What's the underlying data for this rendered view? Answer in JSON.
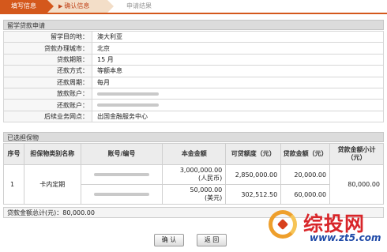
{
  "steps": {
    "step1": "填写信息",
    "step2": "确认信息",
    "step3": "申请结果"
  },
  "loan_section": {
    "title": "留学贷款申请",
    "rows": [
      {
        "label": "留学目的地：",
        "value": "澳大利亚"
      },
      {
        "label": "贷款办理城市：",
        "value": "北京"
      },
      {
        "label": "贷款期限：",
        "value": "15 月"
      },
      {
        "label": "还款方式：",
        "value": "等额本息"
      },
      {
        "label": "还款周期：",
        "value": "每月"
      },
      {
        "label": "放款账户：",
        "value": ""
      },
      {
        "label": "还款账户：",
        "value": ""
      },
      {
        "label": "后续业务网点：",
        "value": "出国金融服务中心"
      }
    ]
  },
  "collateral_section": {
    "title": "已选担保物",
    "headers": {
      "seq": "序号",
      "type": "担保物类别名称",
      "account": "账号/编号",
      "principal": "本金金额",
      "available": "可贷额度（元）",
      "loan_amount": "贷款金额（元）",
      "subtotal": "贷款金额小计（元）"
    },
    "row": {
      "seq": "1",
      "type": "卡内定期",
      "principal_1": "3,000,000.00",
      "principal_1_unit": "(人民币)",
      "principal_2": "50,000.00",
      "principal_2_unit": "(美元)",
      "available_1": "2,850,000.00",
      "available_2": "302,512.50",
      "loan_1": "20,000.00",
      "loan_2": "60,000.00",
      "subtotal": "80,000.00"
    }
  },
  "total": {
    "label": "贷款金额总计(元)：80,000.00"
  },
  "buttons": {
    "confirm": "确 认",
    "back": "返 回"
  },
  "watermark": {
    "brand": "综投网",
    "url": "www.zt5.com"
  }
}
